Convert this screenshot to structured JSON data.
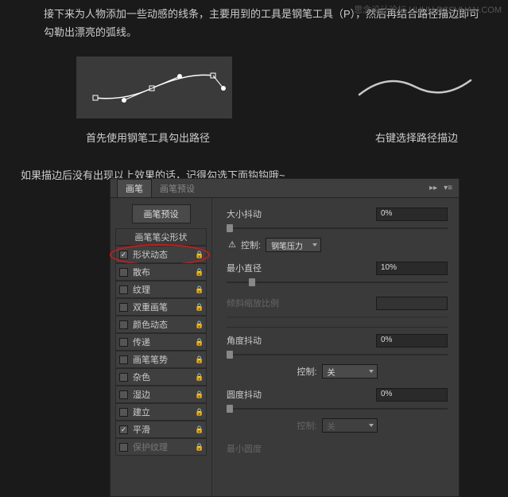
{
  "watermark": "思念设计论坛 UUUU.RSSVUAN.COM",
  "intro": "接下来为人物添加一些动感的线条，主要用到的工具是钢笔工具（P），然后再结合路径描边即可勾勒出漂亮的弧线。",
  "captions": {
    "left": "首先使用钢笔工具勾出路径",
    "right": "右键选择路径描边"
  },
  "note": "如果描边后没有出现以上效果的话，记得勾选下面钩钩哦~",
  "panel": {
    "tabs": {
      "brush": "画笔",
      "presets": "画笔预设"
    },
    "sidebar": {
      "presetBtn": "画笔预设",
      "tipShape": "画笔笔尖形状",
      "items": [
        {
          "label": "形状动态",
          "checked": true,
          "locked": true,
          "highlighted": true
        },
        {
          "label": "散布",
          "checked": false,
          "locked": true
        },
        {
          "label": "纹理",
          "checked": false,
          "locked": true
        },
        {
          "label": "双重画笔",
          "checked": false,
          "locked": true
        },
        {
          "label": "颜色动态",
          "checked": false,
          "locked": true
        },
        {
          "label": "传递",
          "checked": false,
          "locked": true
        },
        {
          "label": "画笔笔势",
          "checked": false,
          "locked": true
        },
        {
          "label": "杂色",
          "checked": false,
          "locked": true
        },
        {
          "label": "湿边",
          "checked": false,
          "locked": true
        },
        {
          "label": "建立",
          "checked": false,
          "locked": true
        },
        {
          "label": "平滑",
          "checked": true,
          "locked": true
        },
        {
          "label": "保护纹理",
          "checked": false,
          "locked": true,
          "dim": true
        }
      ]
    },
    "settings": {
      "sizeJitter": {
        "label": "大小抖动",
        "value": "0%"
      },
      "control1": {
        "label": "控制:",
        "value": "钢笔压力"
      },
      "minDiameter": {
        "label": "最小直径",
        "value": "10%"
      },
      "tiltScale": {
        "label": "倾斜缩放比例"
      },
      "angleJitter": {
        "label": "角度抖动",
        "value": "0%"
      },
      "control2": {
        "label": "控制:",
        "value": "关"
      },
      "roundJitter": {
        "label": "圆度抖动",
        "value": "0%"
      },
      "control3": {
        "label": "控制:",
        "value": "关"
      },
      "minRound": {
        "label": "最小圆度"
      }
    }
  }
}
